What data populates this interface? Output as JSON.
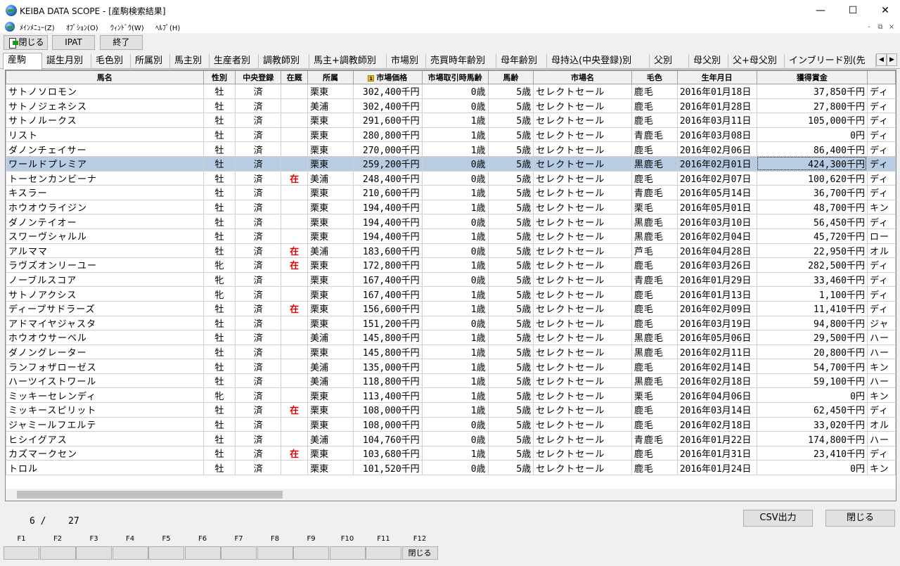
{
  "window": {
    "title": "KEIBA DATA SCOPE - [産駒検索結果]",
    "minimize": "—",
    "maximize": "☐",
    "close": "✕"
  },
  "menu": {
    "items": [
      "ﾒｲﾝﾒﾆｭｰ(Z)",
      "ｵﾌﾟｼｮﾝ(O)",
      "ｳｨﾝﾄﾞｳ(W)",
      "ﾍﾙﾌﾟ(H)"
    ],
    "mdi_minimize": "-",
    "mdi_restore": "⧉",
    "mdi_close": "×"
  },
  "toolbar": {
    "close_label": "閉じる",
    "ipat_label": "IPAT",
    "exit_label": "終了"
  },
  "tabs": [
    "産駒",
    "誕生月別",
    "毛色別",
    "所属別",
    "馬主別",
    "生産者別",
    "調教師別",
    "馬主+調教師別",
    "市場別",
    "売買時年齢別",
    "母年齢別",
    "母持込(中央登録)別",
    "父別",
    "母父別",
    "父+母父別",
    "インブリード別(先"
  ],
  "tab_scroll": {
    "left": "◀",
    "right": "▶"
  },
  "table": {
    "sort_marker": "1",
    "columns": [
      "馬名",
      "性別",
      "中央登録",
      "在厩",
      "所属",
      "市場価格",
      "市場取引時馬齢",
      "馬齢",
      "市場名",
      "毛色",
      "生年月日",
      "獲得賞金",
      ""
    ],
    "rows": [
      [
        "サトノソロモン",
        "牡",
        "済",
        "",
        "栗東",
        "302,400千円",
        "0歳",
        "5歳",
        "セレクトセール",
        "鹿毛",
        "2016年01月18日",
        "37,850千円",
        "ディ"
      ],
      [
        "サトノジェネシス",
        "牡",
        "済",
        "",
        "美浦",
        "302,400千円",
        "0歳",
        "5歳",
        "セレクトセール",
        "鹿毛",
        "2016年01月28日",
        "27,800千円",
        "ディ"
      ],
      [
        "サトノルークス",
        "牡",
        "済",
        "",
        "栗東",
        "291,600千円",
        "1歳",
        "5歳",
        "セレクトセール",
        "鹿毛",
        "2016年03月11日",
        "105,000千円",
        "ディ"
      ],
      [
        "リスト",
        "牡",
        "済",
        "",
        "栗東",
        "280,800千円",
        "1歳",
        "5歳",
        "セレクトセール",
        "青鹿毛",
        "2016年03月08日",
        "0円",
        "ディ"
      ],
      [
        "ダノンチェイサー",
        "牡",
        "済",
        "",
        "栗東",
        "270,000千円",
        "1歳",
        "5歳",
        "セレクトセール",
        "鹿毛",
        "2016年02月06日",
        "86,400千円",
        "ディ"
      ],
      [
        "ワールドプレミア",
        "牡",
        "済",
        "",
        "栗東",
        "259,200千円",
        "0歳",
        "5歳",
        "セレクトセール",
        "黒鹿毛",
        "2016年02月01日",
        "424,300千円",
        "ディ"
      ],
      [
        "トーセンカンビーナ",
        "牡",
        "済",
        "在",
        "美浦",
        "248,400千円",
        "0歳",
        "5歳",
        "セレクトセール",
        "鹿毛",
        "2016年02月07日",
        "100,620千円",
        "ディ"
      ],
      [
        "キスラー",
        "牡",
        "済",
        "",
        "栗東",
        "210,600千円",
        "1歳",
        "5歳",
        "セレクトセール",
        "青鹿毛",
        "2016年05月14日",
        "36,700千円",
        "ディ"
      ],
      [
        "ホウオウライジン",
        "牡",
        "済",
        "",
        "栗東",
        "194,400千円",
        "1歳",
        "5歳",
        "セレクトセール",
        "栗毛",
        "2016年05月01日",
        "48,700千円",
        "キン"
      ],
      [
        "ダノンテイオー",
        "牡",
        "済",
        "",
        "栗東",
        "194,400千円",
        "0歳",
        "5歳",
        "セレクトセール",
        "黒鹿毛",
        "2016年03月10日",
        "56,450千円",
        "ディ"
      ],
      [
        "スワーヴシャルル",
        "牡",
        "済",
        "",
        "栗東",
        "194,400千円",
        "1歳",
        "5歳",
        "セレクトセール",
        "黒鹿毛",
        "2016年02月04日",
        "45,720千円",
        "ロー"
      ],
      [
        "アルママ",
        "牡",
        "済",
        "在",
        "美浦",
        "183,600千円",
        "0歳",
        "5歳",
        "セレクトセール",
        "芦毛",
        "2016年04月28日",
        "22,950千円",
        "オル"
      ],
      [
        "ラヴズオンリーユー",
        "牝",
        "済",
        "在",
        "栗東",
        "172,800千円",
        "1歳",
        "5歳",
        "セレクトセール",
        "鹿毛",
        "2016年03月26日",
        "282,500千円",
        "ディ"
      ],
      [
        "ノーブルスコア",
        "牝",
        "済",
        "",
        "栗東",
        "167,400千円",
        "0歳",
        "5歳",
        "セレクトセール",
        "青鹿毛",
        "2016年01月29日",
        "33,460千円",
        "ディ"
      ],
      [
        "サトノアクシス",
        "牝",
        "済",
        "",
        "栗東",
        "167,400千円",
        "1歳",
        "5歳",
        "セレクトセール",
        "鹿毛",
        "2016年01月13日",
        "1,100千円",
        "ディ"
      ],
      [
        "ディープサドラーズ",
        "牡",
        "済",
        "在",
        "栗東",
        "156,600千円",
        "1歳",
        "5歳",
        "セレクトセール",
        "鹿毛",
        "2016年02月09日",
        "11,410千円",
        "ディ"
      ],
      [
        "アドマイヤジャスタ",
        "牡",
        "済",
        "",
        "栗東",
        "151,200千円",
        "0歳",
        "5歳",
        "セレクトセール",
        "鹿毛",
        "2016年03月19日",
        "94,800千円",
        "ジャ"
      ],
      [
        "ホウオウサーベル",
        "牡",
        "済",
        "",
        "美浦",
        "145,800千円",
        "1歳",
        "5歳",
        "セレクトセール",
        "黒鹿毛",
        "2016年05月06日",
        "29,500千円",
        "ハー"
      ],
      [
        "ダノングレーター",
        "牡",
        "済",
        "",
        "栗東",
        "145,800千円",
        "1歳",
        "5歳",
        "セレクトセール",
        "黒鹿毛",
        "2016年02月11日",
        "20,800千円",
        "ハー"
      ],
      [
        "ランフォザローゼス",
        "牡",
        "済",
        "",
        "美浦",
        "135,000千円",
        "1歳",
        "5歳",
        "セレクトセール",
        "鹿毛",
        "2016年02月14日",
        "54,700千円",
        "キン"
      ],
      [
        "ハーツイストワール",
        "牡",
        "済",
        "",
        "美浦",
        "118,800千円",
        "1歳",
        "5歳",
        "セレクトセール",
        "黒鹿毛",
        "2016年02月18日",
        "59,100千円",
        "ハー"
      ],
      [
        "ミッキーセレンディ",
        "牝",
        "済",
        "",
        "栗東",
        "113,400千円",
        "1歳",
        "5歳",
        "セレクトセール",
        "栗毛",
        "2016年04月06日",
        "0円",
        "キン"
      ],
      [
        "ミッキースピリット",
        "牡",
        "済",
        "在",
        "栗東",
        "108,000千円",
        "1歳",
        "5歳",
        "セレクトセール",
        "鹿毛",
        "2016年03月14日",
        "62,450千円",
        "ディ"
      ],
      [
        "ジャミールフエルテ",
        "牡",
        "済",
        "",
        "栗東",
        "108,000千円",
        "0歳",
        "5歳",
        "セレクトセール",
        "鹿毛",
        "2016年02月18日",
        "33,020千円",
        "オル"
      ],
      [
        "ヒシイグアス",
        "牡",
        "済",
        "",
        "美浦",
        "104,760千円",
        "0歳",
        "5歳",
        "セレクトセール",
        "青鹿毛",
        "2016年01月22日",
        "174,800千円",
        "ハー"
      ],
      [
        "カズマークセン",
        "牡",
        "済",
        "在",
        "栗東",
        "103,680千円",
        "1歳",
        "5歳",
        "セレクトセール",
        "鹿毛",
        "2016年01月31日",
        "23,410千円",
        "ディ"
      ],
      [
        "トロル",
        "牡",
        "済",
        "",
        "栗東",
        "101,520千円",
        "0歳",
        "5歳",
        "セレクトセール",
        "鹿毛",
        "2016年01月24日",
        "0円",
        "キン"
      ]
    ],
    "selected_row": 5
  },
  "status": {
    "current": "6 /",
    "total": "27"
  },
  "bottom": {
    "csv_label": "CSV出力",
    "close_label": "閉じる"
  },
  "fkeys": [
    {
      "label": "F1",
      "button": ""
    },
    {
      "label": "F2",
      "button": ""
    },
    {
      "label": "F3",
      "button": ""
    },
    {
      "label": "F4",
      "button": ""
    },
    {
      "label": "F5",
      "button": ""
    },
    {
      "label": "F6",
      "button": ""
    },
    {
      "label": "F7",
      "button": ""
    },
    {
      "label": "F8",
      "button": ""
    },
    {
      "label": "F9",
      "button": ""
    },
    {
      "label": "F10",
      "button": ""
    },
    {
      "label": "F11",
      "button": ""
    },
    {
      "label": "F12",
      "button": "閉じる"
    }
  ],
  "colors": {
    "selected_row": "#b8cce4",
    "in_stable": "#e00000"
  }
}
